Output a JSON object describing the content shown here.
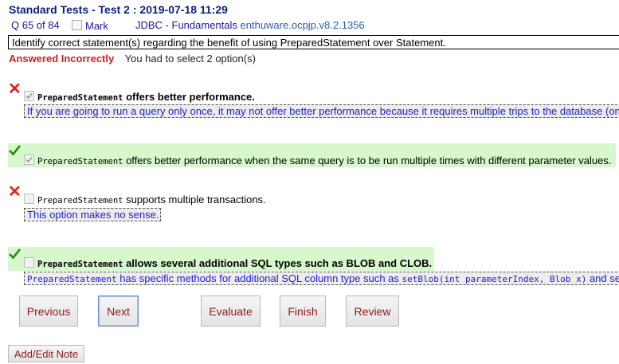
{
  "header": {
    "title": "Standard Tests - Test 2 : 2019-07-18 11:29",
    "question_counter": "Q 65 of 84",
    "mark_label": "Mark",
    "topic": "JDBC - Fundamentals",
    "source": "enthuware.ocpjp.v8.2.1356"
  },
  "question": {
    "text": "Identify correct statement(s) regarding the benefit of using PreparedStatement over Statement."
  },
  "result": {
    "status": "Answered Incorrectly",
    "instruction": "You had to select 2 option(s)"
  },
  "options": [
    {
      "code": "PreparedStatement",
      "text": " offers better performance.",
      "checked": true,
      "correct": false,
      "explanation": "If you are going to run a query only once, it may not offer better performance because it requires multiple trips to the database (on"
    },
    {
      "code": "PreparedStatement",
      "text": " offers better performance when the same query is to be run multiple times with different parameter values.",
      "checked": true,
      "correct": true
    },
    {
      "code": "PreparedStatement",
      "text": " supports multiple transactions.",
      "checked": false,
      "correct": false,
      "explanation": "This option makes no sense."
    },
    {
      "code": "PreparedStatement",
      "text": " allows several additional SQL types such as BLOB and CLOB.",
      "checked": false,
      "correct": true,
      "explanation_code1": "PreparedStatement",
      "explanation_text": " has specific methods for additional SQL column type such as ",
      "explanation_code2": "setBlob(int parameterIndex, Blob x)",
      "explanation_tail": " and set"
    }
  ],
  "buttons": {
    "previous": "Previous",
    "next": "Next",
    "evaluate": "Evaluate",
    "finish": "Finish",
    "review": "Review",
    "add_note": "Add/Edit Note"
  },
  "colors": {
    "wrong": "#e0201a",
    "correct": "#2a8a1a",
    "correct_band": "#d6f8cc",
    "explanation_text": "#2222cc"
  }
}
